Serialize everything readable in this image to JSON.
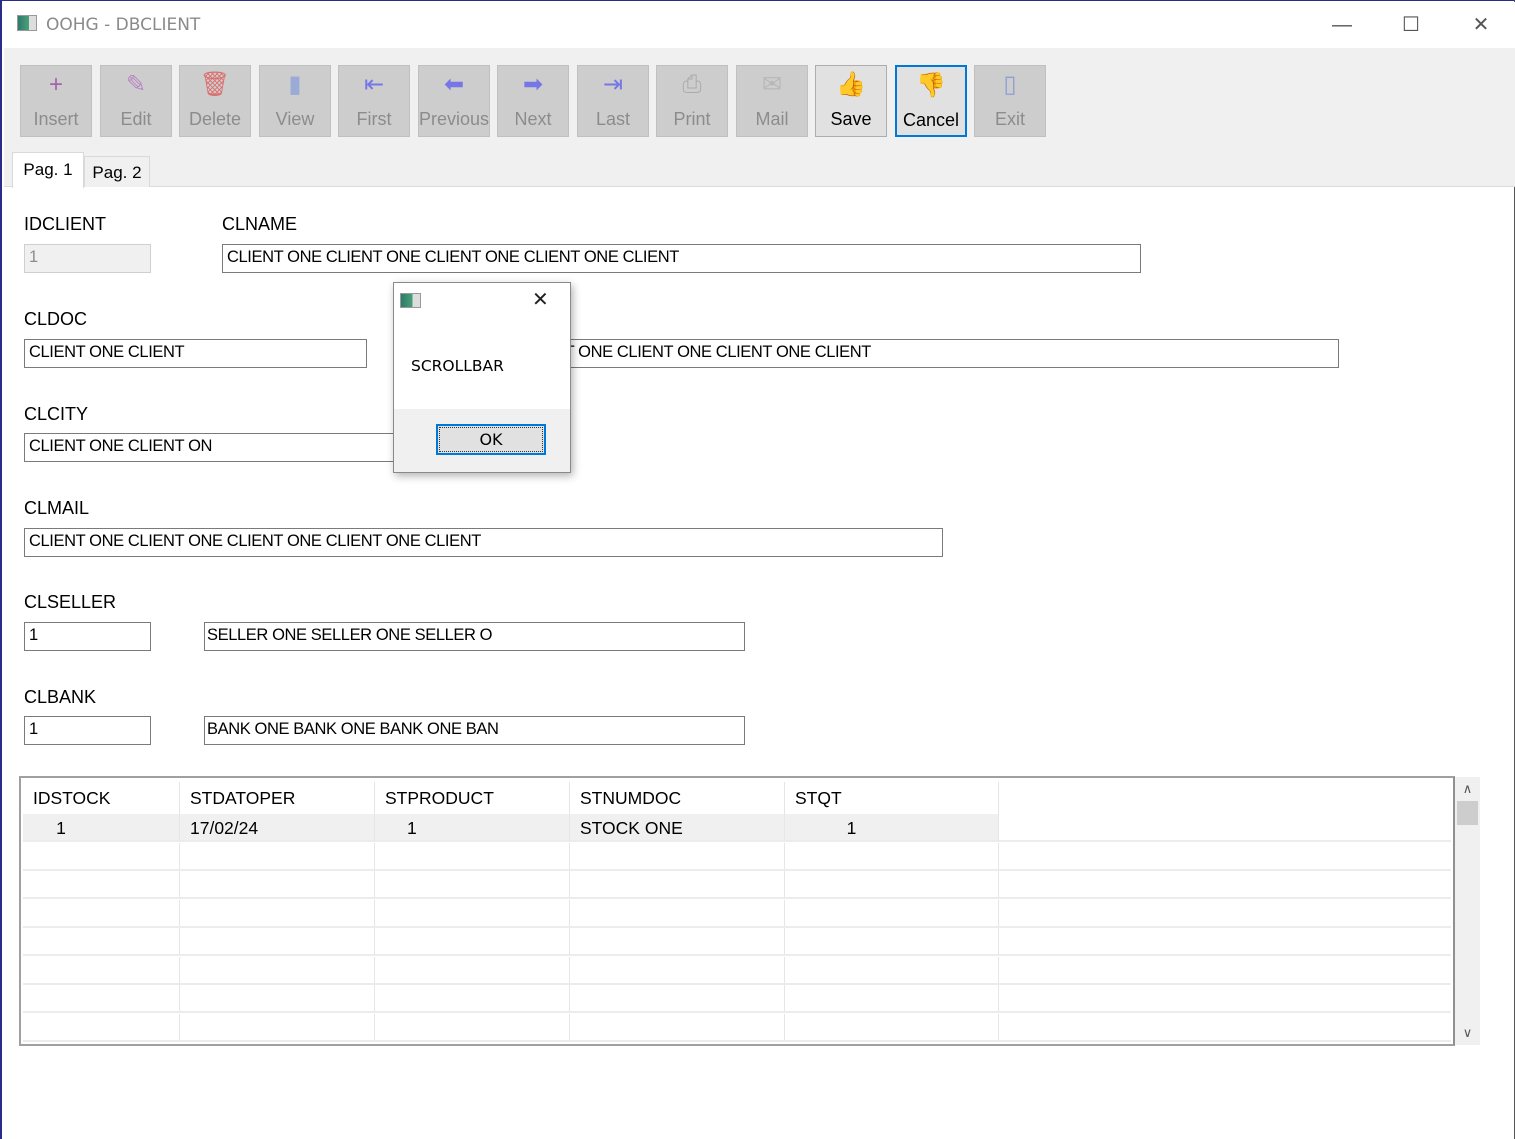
{
  "window": {
    "title": "OOHG - DBCLIENT",
    "minimize": "—",
    "maximize": "☐",
    "close": "✕"
  },
  "toolbar": [
    {
      "label": "Insert",
      "icon": "+",
      "color": "#9b3fa0",
      "enabled": false
    },
    {
      "label": "Edit",
      "icon": "✎",
      "color": "#b070c0",
      "enabled": false
    },
    {
      "label": "Delete",
      "icon": "🗑",
      "color": "#e05050",
      "enabled": false
    },
    {
      "label": "View",
      "icon": "▮",
      "color": "#8aa0d8",
      "enabled": false
    },
    {
      "label": "First",
      "icon": "⇤",
      "color": "#5a5af0",
      "enabled": false
    },
    {
      "label": "Previous",
      "icon": "⬅",
      "color": "#5a5af0",
      "enabled": false
    },
    {
      "label": "Next",
      "icon": "➡",
      "color": "#5a5af0",
      "enabled": false
    },
    {
      "label": "Last",
      "icon": "⇥",
      "color": "#5a5af0",
      "enabled": false
    },
    {
      "label": "Print",
      "icon": "⎙",
      "color": "#a0a0a0",
      "enabled": false
    },
    {
      "label": "Mail",
      "icon": "✉",
      "color": "#b0b0b0",
      "enabled": false
    },
    {
      "label": "Save",
      "icon": "👍",
      "color": "#800080",
      "enabled": true
    },
    {
      "label": "Cancel",
      "icon": "👎",
      "color": "#800080",
      "enabled": true
    },
    {
      "label": "Exit",
      "icon": "▯",
      "color": "#7a90d8",
      "enabled": false
    }
  ],
  "tabs": [
    "Pag. 1",
    "Pag. 2"
  ],
  "form": {
    "idclient": {
      "label": "IDCLIENT",
      "value": "1"
    },
    "clname": {
      "label": "CLNAME",
      "value": "CLIENT ONE CLIENT ONE CLIENT ONE CLIENT ONE CLIENT"
    },
    "cldoc": {
      "label": "CLDOC",
      "value": "CLIENT ONE CLIENT"
    },
    "cldoc2": {
      "value": "CLIENT ONE CLIENT ONE CLIENT ONE CLIENT"
    },
    "clcity": {
      "label": "CLCITY",
      "value": "CLIENT ONE CLIENT ON"
    },
    "clmail": {
      "label": "CLMAIL",
      "value": "CLIENT ONE CLIENT ONE CLIENT ONE CLIENT ONE CLIENT"
    },
    "clseller": {
      "label": "CLSELLER",
      "value": "1",
      "name": "SELLER ONE SELLER ONE SELLER O"
    },
    "clbank": {
      "label": "CLBANK",
      "value": "1",
      "name": "BANK ONE BANK ONE BANK ONE BAN"
    }
  },
  "grid": {
    "columns": [
      "IDSTOCK",
      "STDATOPER",
      "STPRODUCT",
      "STNUMDOC",
      "STQT"
    ],
    "rows": [
      [
        "1",
        "17/02/24",
        "1",
        "STOCK ONE",
        "1"
      ]
    ]
  },
  "dialog": {
    "message": "SCROLLBAR",
    "ok": "OK",
    "close": "✕"
  }
}
